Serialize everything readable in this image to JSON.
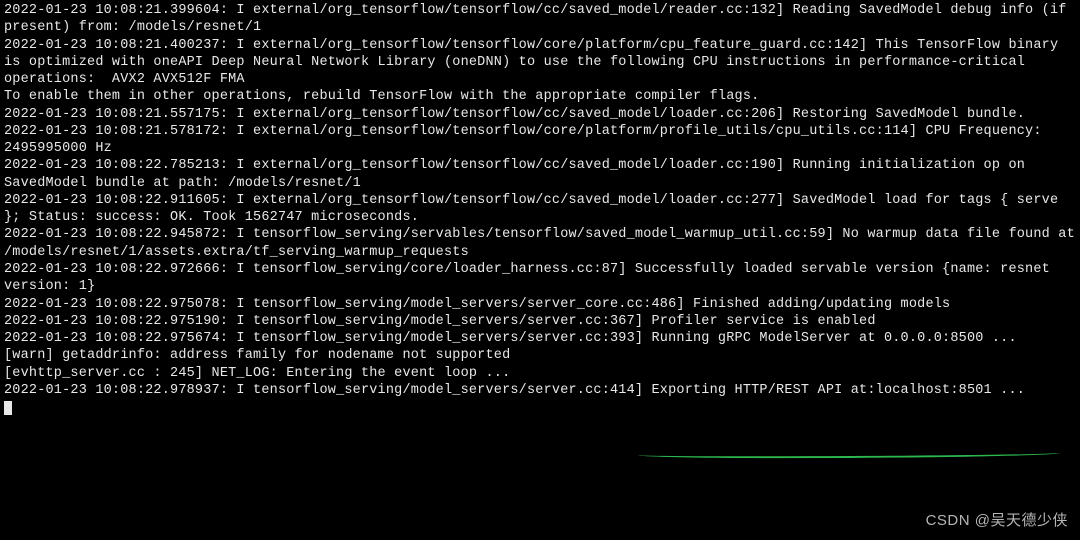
{
  "log": {
    "lines": [
      "2022-01-23 10:08:21.399604: I external/org_tensorflow/tensorflow/cc/saved_model/reader.cc:132] Reading SavedModel debug info (if present) from: /models/resnet/1",
      "2022-01-23 10:08:21.400237: I external/org_tensorflow/tensorflow/core/platform/cpu_feature_guard.cc:142] This TensorFlow binary is optimized with oneAPI Deep Neural Network Library (oneDNN) to use the following CPU instructions in performance-critical operations:  AVX2 AVX512F FMA",
      "To enable them in other operations, rebuild TensorFlow with the appropriate compiler flags.",
      "2022-01-23 10:08:21.557175: I external/org_tensorflow/tensorflow/cc/saved_model/loader.cc:206] Restoring SavedModel bundle.",
      "2022-01-23 10:08:21.578172: I external/org_tensorflow/tensorflow/core/platform/profile_utils/cpu_utils.cc:114] CPU Frequency: 2495995000 Hz",
      "2022-01-23 10:08:22.785213: I external/org_tensorflow/tensorflow/cc/saved_model/loader.cc:190] Running initialization op on SavedModel bundle at path: /models/resnet/1",
      "2022-01-23 10:08:22.911605: I external/org_tensorflow/tensorflow/cc/saved_model/loader.cc:277] SavedModel load for tags { serve }; Status: success: OK. Took 1562747 microseconds.",
      "2022-01-23 10:08:22.945872: I tensorflow_serving/servables/tensorflow/saved_model_warmup_util.cc:59] No warmup data file found at /models/resnet/1/assets.extra/tf_serving_warmup_requests",
      "2022-01-23 10:08:22.972666: I tensorflow_serving/core/loader_harness.cc:87] Successfully loaded servable version {name: resnet version: 1}",
      "2022-01-23 10:08:22.975078: I tensorflow_serving/model_servers/server_core.cc:486] Finished adding/updating models",
      "2022-01-23 10:08:22.975190: I tensorflow_serving/model_servers/server.cc:367] Profiler service is enabled",
      "2022-01-23 10:08:22.975674: I tensorflow_serving/model_servers/server.cc:393] Running gRPC ModelServer at 0.0.0.0:8500 ...",
      "[warn] getaddrinfo: address family for nodename not supported",
      "[evhttp_server.cc : 245] NET_LOG: Entering the event loop ...",
      "2022-01-23 10:08:22.978937: I tensorflow_serving/model_servers/server.cc:414] Exporting HTTP/REST API at:localhost:8501 ..."
    ],
    "highlighted_text": "Exporting HTTP/REST API at:localhost:8501"
  },
  "watermark": {
    "text": "CSDN @吴天德少侠"
  },
  "colors": {
    "background": "#000000",
    "text": "#e8e8e8",
    "underline": "#2db84d",
    "watermark": "#b5b5b5"
  }
}
